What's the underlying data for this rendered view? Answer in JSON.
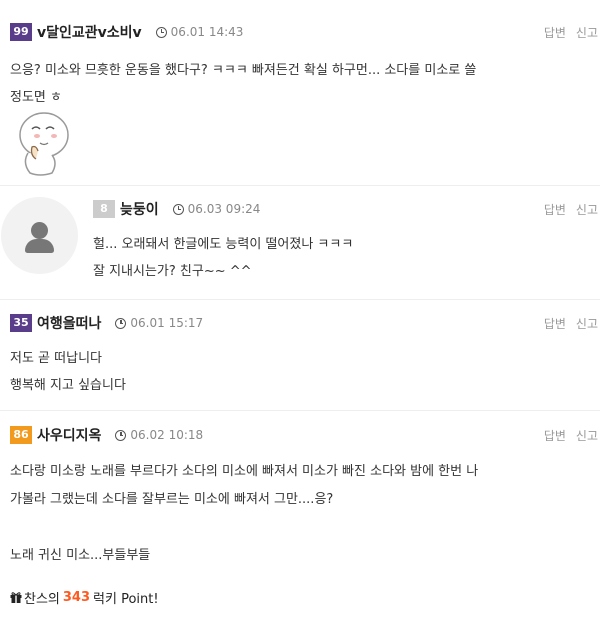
{
  "colors": {
    "level_purple": "#5a3d8a",
    "level_gray": "#cccccc",
    "level_orange": "#f29a1d",
    "lucky_number": "#ff5a1f"
  },
  "actions": {
    "reply": "답변",
    "report": "신고"
  },
  "comments": [
    {
      "level": "99",
      "nickname": "v달인교관v소비v",
      "time": "06.01 14:43",
      "text_lines": [
        "으응? 미소와 므흣한 운동을 했다구? ㅋㅋㅋ  빠져든건 확실 하구먼... 소다를 미소로 쓸",
        "정도면 ㅎ"
      ],
      "emoticon": "thinking-character-emoticon"
    },
    {
      "level": "8",
      "nickname": "늦둥이",
      "time": "06.03 09:24",
      "text_lines": [
        "헐... 오래돼서 한글에도 능력이 떨어졌나 ㅋㅋㅋ",
        "잘 지내시는가? 친구~~ ^^"
      ],
      "avatar": "default-user-avatar-icon"
    },
    {
      "level": "35",
      "nickname": "여행을떠나",
      "time": "06.01 15:17",
      "text_lines": [
        "저도 곧 떠납니다",
        "행복해 지고 싶습니다"
      ]
    },
    {
      "level": "86",
      "nickname": "사우디지옥",
      "time": "06.02 10:18",
      "text_lines": [
        "소다랑 미소랑 노래를 부르다가 소다의 미소에 빠져서 미소가 빠진 소다와 밤에 한번 나",
        "가볼라 그랬는데 소다를 잘부르는 미소에 빠져서 그만....응?",
        "",
        "노래 귀신 미소...부들부들"
      ],
      "lucky": {
        "prefix": "찬스의",
        "number": "343",
        "suffix": "럭키 Point!"
      }
    }
  ]
}
